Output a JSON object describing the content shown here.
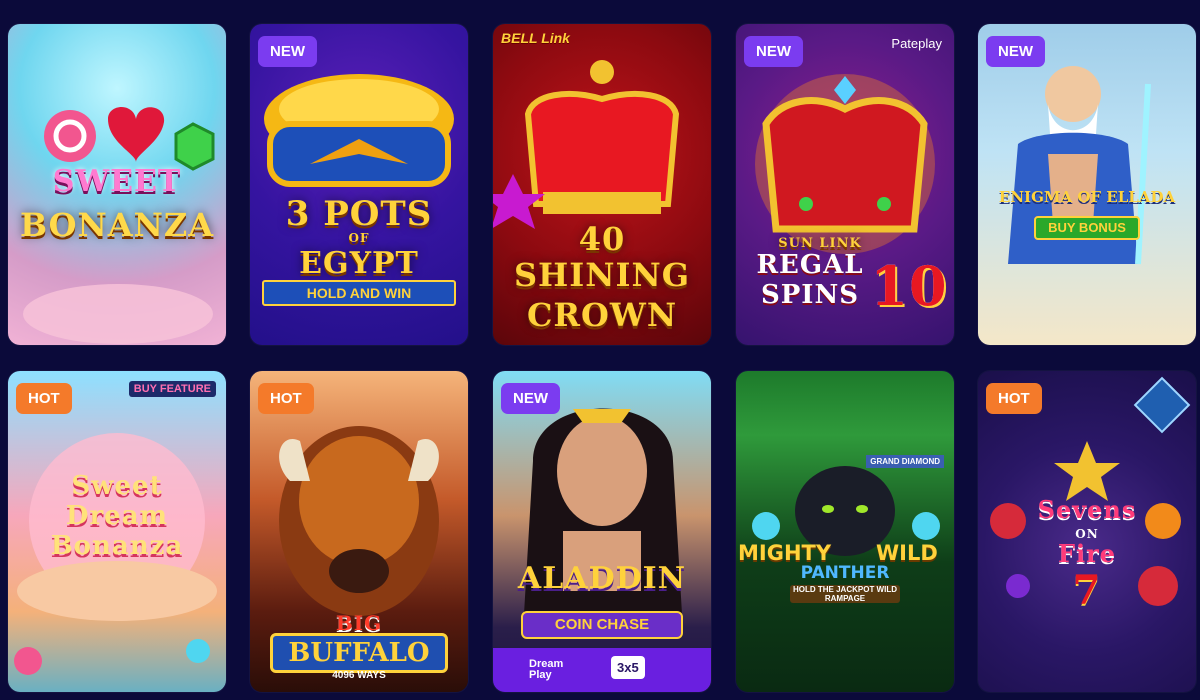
{
  "colors": {
    "page_bg": "#0b0a3a",
    "badge_new": "#7b3cf0",
    "badge_hot": "#f47a2a"
  },
  "games": [
    {
      "title_lines": [
        "SWEET",
        "BONANZA"
      ],
      "badge": ""
    },
    {
      "title_lines": [
        "3 POTS",
        "OF",
        "EGYPT"
      ],
      "subtitle": "HOLD AND WIN",
      "badge": "NEW"
    },
    {
      "title_lines": [
        "40",
        "SHINING",
        "CROWN"
      ],
      "corner": "BELL Link",
      "badge": ""
    },
    {
      "title_lines": [
        "SUN LINK",
        "REGAL",
        "SPINS",
        "10"
      ],
      "corner": "Pateplay",
      "badge": "NEW"
    },
    {
      "title_lines": [
        "ENIGMA OF ELLADA"
      ],
      "subtitle": "BUY BONUS",
      "badge": "NEW"
    },
    {
      "title_lines": [
        "Sweet",
        "Dream",
        "Bonanza"
      ],
      "corner": "BUY FEATURE",
      "badge": "HOT"
    },
    {
      "title_lines": [
        "BIG",
        "BUFFALO"
      ],
      "subtitle": "4096 WAYS",
      "badge": "HOT"
    },
    {
      "title_lines": [
        "ALADDIN"
      ],
      "subtitle": "COIN CHASE",
      "footer_left": "Dream Play",
      "footer_right": "3x5",
      "badge": "NEW"
    },
    {
      "title_lines": [
        "MIGHTY",
        "WILD",
        "PANTHER"
      ],
      "subtitle": "HOLD THE JACKPOT WILD RAMPAGE",
      "corner": "GRAND DIAMOND",
      "badge": ""
    },
    {
      "title_lines": [
        "Sevens",
        "ON",
        "Fire"
      ],
      "badge": "HOT"
    }
  ]
}
